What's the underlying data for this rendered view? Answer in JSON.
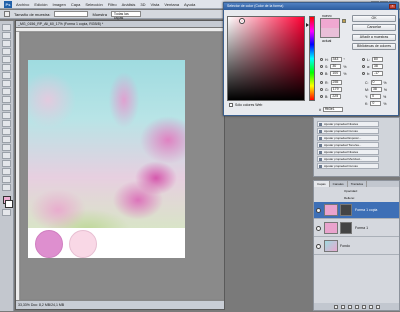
{
  "menu": {
    "logo": "Ps",
    "items": [
      "Archivo",
      "Edición",
      "Imagen",
      "Capa",
      "Selección",
      "Filtro",
      "Análisis",
      "3D",
      "Vista",
      "Ventana",
      "Ayuda"
    ]
  },
  "options_bar": {
    "sample_size_label": "Tamaño de muestra:",
    "sample_value": "Muestra",
    "all_layers": "Todas las capas"
  },
  "document": {
    "tab_title": "_MG_0156_RP_Ali_60_17% (Forma 1 copia, RGB/8) *",
    "status": "33,33%   Doc: 8,2 MB/24,1 MB"
  },
  "colors": {
    "foreground": "#eeaed2",
    "circle_dark": "#de8fcf",
    "circle_light": "#f9d8e6"
  },
  "picker": {
    "title": "Selector de color (Color de la forma)",
    "new_label": "nuevo",
    "current_label": "actual",
    "buttons": [
      "OK",
      "Cancelar",
      "Añadir a muestras",
      "Bibliotecas de colores"
    ],
    "web_only": "Sólo colores Web",
    "hsb": [
      {
        "label": "H:",
        "value": "343",
        "unit": "°"
      },
      {
        "label": "S:",
        "value": "30",
        "unit": "%"
      },
      {
        "label": "B:",
        "value": "100",
        "unit": "%"
      }
    ],
    "rgb": [
      {
        "label": "R:",
        "value": "255"
      },
      {
        "label": "G:",
        "value": "179"
      },
      {
        "label": "B:",
        "value": "225"
      }
    ],
    "lab": [
      {
        "label": "L:",
        "value": "80"
      },
      {
        "label": "a:",
        "value": "38"
      },
      {
        "label": "b:",
        "value": "-17"
      }
    ],
    "cmyk": [
      {
        "label": "C:",
        "value": "0",
        "unit": "%"
      },
      {
        "label": "M:",
        "value": "38",
        "unit": "%"
      },
      {
        "label": "Y:",
        "value": "0",
        "unit": "%"
      },
      {
        "label": "K:",
        "value": "0",
        "unit": "%"
      }
    ],
    "hex_label": "#",
    "hex": "ffb3e1"
  },
  "history": {
    "items": [
      "Ajustar propiedad Niveles",
      "Ajustar propiedad Curvas",
      "Ajustar propiedad Exposic...",
      "Ajustar propiedad Tono/sa...",
      "Ajustar propiedad Niveles",
      "Ajustar propiedad Mezclad...",
      "Ajustar propiedad Curvas"
    ]
  },
  "layers": {
    "tabs": [
      "Capas",
      "Canales",
      "Trazados"
    ],
    "opacity_label": "Opacidad:",
    "fill_label": "Relleno:",
    "rows": [
      {
        "name": "Forma 1 copia",
        "thumb": "#e9a3cd"
      },
      {
        "name": "Forma 1",
        "thumb": "#e9a3cd"
      },
      {
        "name": "Fondo",
        "thumb": "#e7a9cf"
      }
    ]
  }
}
